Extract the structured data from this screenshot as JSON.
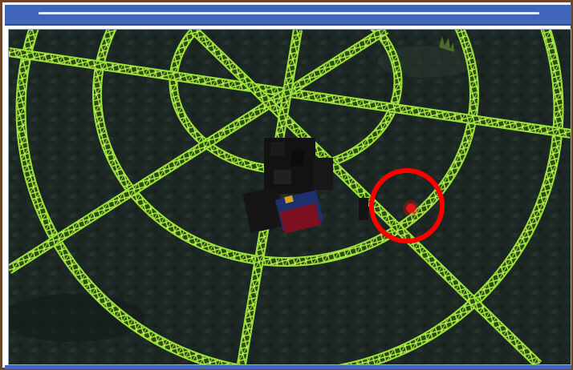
{
  "window": {
    "title": ""
  },
  "scene": {
    "description_tag": "minecraft-night-ground-with-glowing-web-pattern",
    "colors": {
      "ground": "#1c2622",
      "web_glow": "#9be33a",
      "web_dark": "#3a5a12",
      "marker": "#ff0000",
      "frame_blue": "#3f66b8",
      "frame_brown": "#6b4528"
    },
    "player": {
      "icon": "pixelated-player-icon"
    },
    "highlight": {
      "icon": "red-circle-marker-icon",
      "dot_icon": "red-dot-icon"
    }
  }
}
